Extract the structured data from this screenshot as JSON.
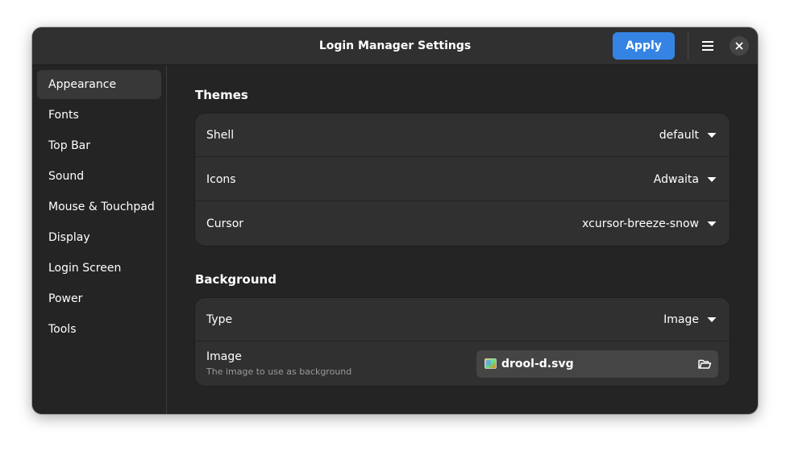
{
  "window": {
    "title": "Login Manager Settings",
    "apply_label": "Apply"
  },
  "sidebar": {
    "items": [
      {
        "label": "Appearance",
        "selected": true
      },
      {
        "label": "Fonts"
      },
      {
        "label": "Top Bar"
      },
      {
        "label": "Sound"
      },
      {
        "label": "Mouse & Touchpad"
      },
      {
        "label": "Display"
      },
      {
        "label": "Login Screen"
      },
      {
        "label": "Power"
      },
      {
        "label": "Tools"
      }
    ]
  },
  "themes": {
    "title": "Themes",
    "rows": [
      {
        "label": "Shell",
        "value": "default"
      },
      {
        "label": "Icons",
        "value": "Adwaita"
      },
      {
        "label": "Cursor",
        "value": "xcursor-breeze-snow"
      }
    ]
  },
  "background": {
    "title": "Background",
    "type_label": "Type",
    "type_value": "Image",
    "image_label": "Image",
    "image_subtitle": "The image to use as background",
    "image_file": "drool-d.svg"
  },
  "icons": {
    "menu": "hamburger-menu-icon",
    "close": "close-icon",
    "dropdown": "dropdown-arrow-icon",
    "file": "image-file-icon",
    "folder": "folder-open-icon"
  },
  "colors": {
    "accent": "#3584e4",
    "window_bg": "#242424",
    "headerbar_bg": "#303030",
    "card_bg": "#303030"
  }
}
